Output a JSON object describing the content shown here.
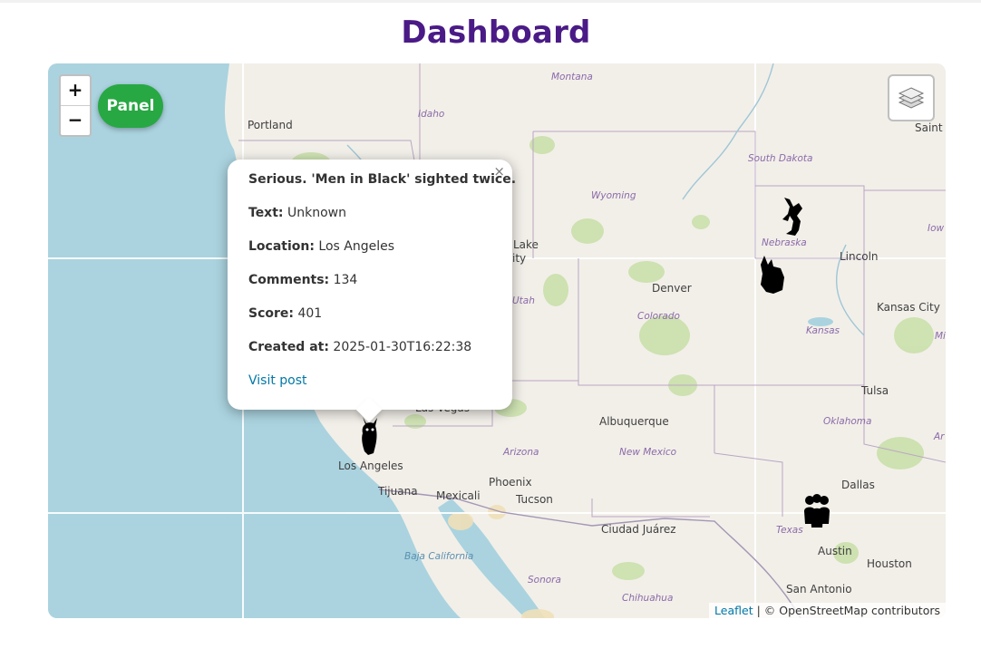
{
  "header": {
    "title": "Dashboard"
  },
  "controls": {
    "zoom_in": "+",
    "zoom_out": "−",
    "panel_label": "Panel",
    "layers_icon": "layers-icon"
  },
  "map": {
    "labels": {
      "montana": "Montana",
      "idaho": "Idaho",
      "portland": "Portland",
      "south_dakota": "South Dakota",
      "saint": "Saint",
      "wyoming": "Wyoming",
      "nebraska": "Nebraska",
      "lincoln": "Lincoln",
      "iowa": "Iow",
      "lake": "Lake",
      "city": "ity",
      "denver": "Denver",
      "utah": "Utah",
      "colorado": "Colorado",
      "kansas_city": "Kansas City",
      "kansas": "Kansas",
      "missouri": "Mi",
      "tulsa": "Tulsa",
      "las_vegas": "Las Vegas",
      "albuquerque": "Albuquerque",
      "oklahoma": "Oklahoma",
      "arkansas": "Ar",
      "arizona": "Arizona",
      "new_mexico": "New Mexico",
      "los_angeles": "Los Angeles",
      "phoenix": "Phoenix",
      "dallas": "Dallas",
      "tijuana": "Tijuana",
      "mexicali": "Mexicali",
      "tucson": "Tucson",
      "ciudad_juarez": "Ciudad Juárez",
      "texas": "Texas",
      "austin": "Austin",
      "baja_california": "Baja California",
      "sonora": "Sonora",
      "houston": "Houston",
      "san_antonio": "San Antonio",
      "chihuahua": "Chihuahua"
    },
    "attribution": {
      "leaflet": "Leaflet",
      "separator": " | ",
      "osm": "© OpenStreetMap contributors"
    }
  },
  "markers": [
    {
      "icon": "creature-marker-icon",
      "location": "Nebraska"
    },
    {
      "icon": "creature-marker-icon",
      "location": "Kansas"
    },
    {
      "icon": "alien-marker-icon",
      "location": "Los Angeles"
    },
    {
      "icon": "people-marker-icon",
      "location": "Texas"
    }
  ],
  "popup": {
    "title": "Serious. 'Men in Black' sighted twice.",
    "text_label": "Text:",
    "text_value": "Unknown",
    "location_label": "Location:",
    "location_value": "Los Angeles",
    "comments_label": "Comments:",
    "comments_value": "134",
    "score_label": "Score:",
    "score_value": "401",
    "created_label": "Created at:",
    "created_value": "2025-01-30T16:22:38",
    "link_label": "Visit post",
    "close": "×"
  },
  "colors": {
    "title": "#4a1a86",
    "panel": "#27a843",
    "water": "#aad3df",
    "land": "#f2efe9",
    "link": "#0078a8"
  }
}
